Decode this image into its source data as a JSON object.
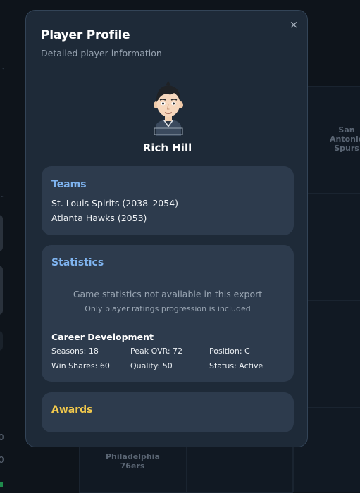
{
  "background": {
    "team_labels": [
      "San Antonio Spurs",
      "Philadelphia 76ers"
    ],
    "left_numbers": [
      "0",
      "0"
    ]
  },
  "modal": {
    "title": "Player Profile",
    "subtitle": "Detailed player information",
    "close_label": "×",
    "player_name": "Rich Hill",
    "teams": {
      "heading": "Teams",
      "items": [
        "St. Louis Spirits (2038–2054)",
        "Atlanta Hawks (2053)"
      ]
    },
    "statistics": {
      "heading": "Statistics",
      "unavailable": "Game statistics not available in this export",
      "note": "Only player ratings progression is included",
      "career_heading": "Career Development",
      "seasons": "Seasons: 18",
      "peak_ovr": "Peak OVR: 72",
      "position": "Position: C",
      "win_shares": "Win Shares: 60",
      "quality": "Quality: 50",
      "status": "Status: Active"
    },
    "awards": {
      "heading": "Awards"
    }
  },
  "colors": {
    "modal_bg": "#1e2a38",
    "card_bg": "#2d3b4d",
    "heading_blue": "#7fb4f0",
    "awards_gold": "#f2c94c"
  }
}
